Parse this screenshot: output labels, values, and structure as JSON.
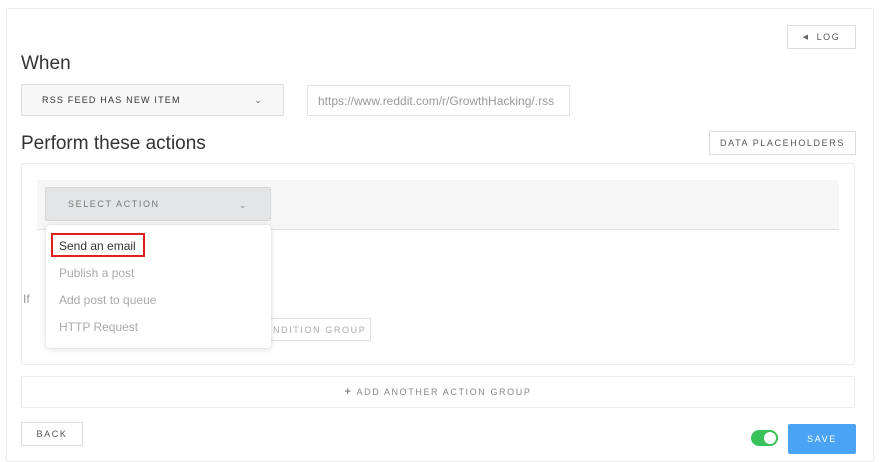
{
  "header": {
    "log_label": "LOG",
    "log_icon": "triangle-left-icon"
  },
  "when": {
    "heading": "When",
    "trigger_value": "RSS FEED HAS NEW ITEM",
    "url_value": "https://www.reddit.com/r/GrowthHacking/.rss"
  },
  "perform": {
    "heading": "Perform these actions",
    "placeholders_label": "DATA PLACEHOLDERS",
    "select_action_label": "SELECT ACTION",
    "behind_if_text": "If",
    "behind_condition_label": "NDITION GROUP",
    "dropdown_options": [
      "Send an email",
      "Publish a post",
      "Add post to queue",
      "HTTP Request"
    ]
  },
  "add_group_label": "ADD ANOTHER ACTION GROUP",
  "footer": {
    "back_label": "BACK",
    "save_label": "SAVE",
    "toggle_on": true
  },
  "colors": {
    "accent_blue": "#4aa3f4",
    "toggle_green": "#3ac25a",
    "highlight_red": "#e02020"
  }
}
